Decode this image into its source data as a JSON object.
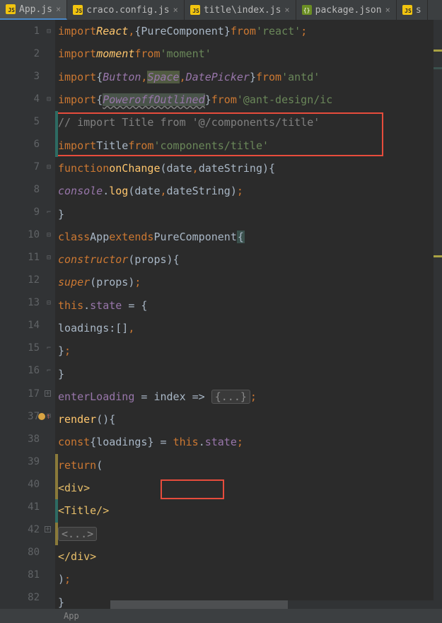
{
  "tabs": [
    {
      "label": "App.js",
      "active": true,
      "icon": "js"
    },
    {
      "label": "craco.config.js",
      "active": false,
      "icon": "js"
    },
    {
      "label": "title\\index.js",
      "active": false,
      "icon": "js"
    },
    {
      "label": "package.json",
      "active": false,
      "icon": "json"
    },
    {
      "label": "s",
      "active": false,
      "icon": "js"
    }
  ],
  "lines": {
    "l1": {
      "n": "1"
    },
    "l2": {
      "n": "2"
    },
    "l3": {
      "n": "3"
    },
    "l4": {
      "n": "4"
    },
    "l5": {
      "n": "5"
    },
    "l6": {
      "n": "6"
    },
    "l7": {
      "n": "7"
    },
    "l8": {
      "n": "8"
    },
    "l9": {
      "n": "9"
    },
    "l10": {
      "n": "10"
    },
    "l11": {
      "n": "11"
    },
    "l12": {
      "n": "12"
    },
    "l13": {
      "n": "13"
    },
    "l14": {
      "n": "14"
    },
    "l15": {
      "n": "15"
    },
    "l16": {
      "n": "16"
    },
    "l17": {
      "n": "17"
    },
    "l37": {
      "n": "37"
    },
    "l38": {
      "n": "38"
    },
    "l39": {
      "n": "39"
    },
    "l40": {
      "n": "40"
    },
    "l41": {
      "n": "41"
    },
    "l42": {
      "n": "42"
    },
    "l80": {
      "n": "80"
    },
    "l81": {
      "n": "81"
    },
    "l82": {
      "n": "82"
    }
  },
  "tk": {
    "import": "import",
    "from": "from",
    "react_i": "React",
    "comma": ",",
    "space": " ",
    "lb": "{",
    "rb": "}",
    "lp": "(",
    "rp": ")",
    "semi": ";",
    "pure": "PureComponent",
    "react_s": "'react'",
    "moment_i": "moment",
    "moment_s": "'moment'",
    "button": "Button",
    "space_w": "Space",
    "datepicker": "DatePicker",
    "antd_s": "'antd'",
    "poweroff": "PoweroffOutlined",
    "antdesign_s": "'@ant-design/ic",
    "cmt_title": "// import Title from '@/components/title'",
    "title": "Title",
    "comp_title_s": "'components/title'",
    "function": "function",
    "onchange": "onChange",
    "date": "date",
    "datestring": "dateString",
    "console": "console",
    "log": "log",
    "class": "class",
    "app": "App",
    "extends": "extends",
    "constructor": "constructor",
    "props": "props",
    "super": "super",
    "this": "this",
    "dot": ".",
    "state": "state",
    "eq": " = ",
    "loadings": "loadings",
    "colon": ":",
    "arr": "[]",
    "enterloading": "enterLoading",
    "index": "index",
    "arrow": " => ",
    "dots": "{...}",
    "render": "render",
    "const": "const",
    "return": "return",
    "div_o": "<div>",
    "div_c": "</div>",
    "title_tag": "<Title/>",
    "frag": "<...>"
  },
  "status": "App"
}
